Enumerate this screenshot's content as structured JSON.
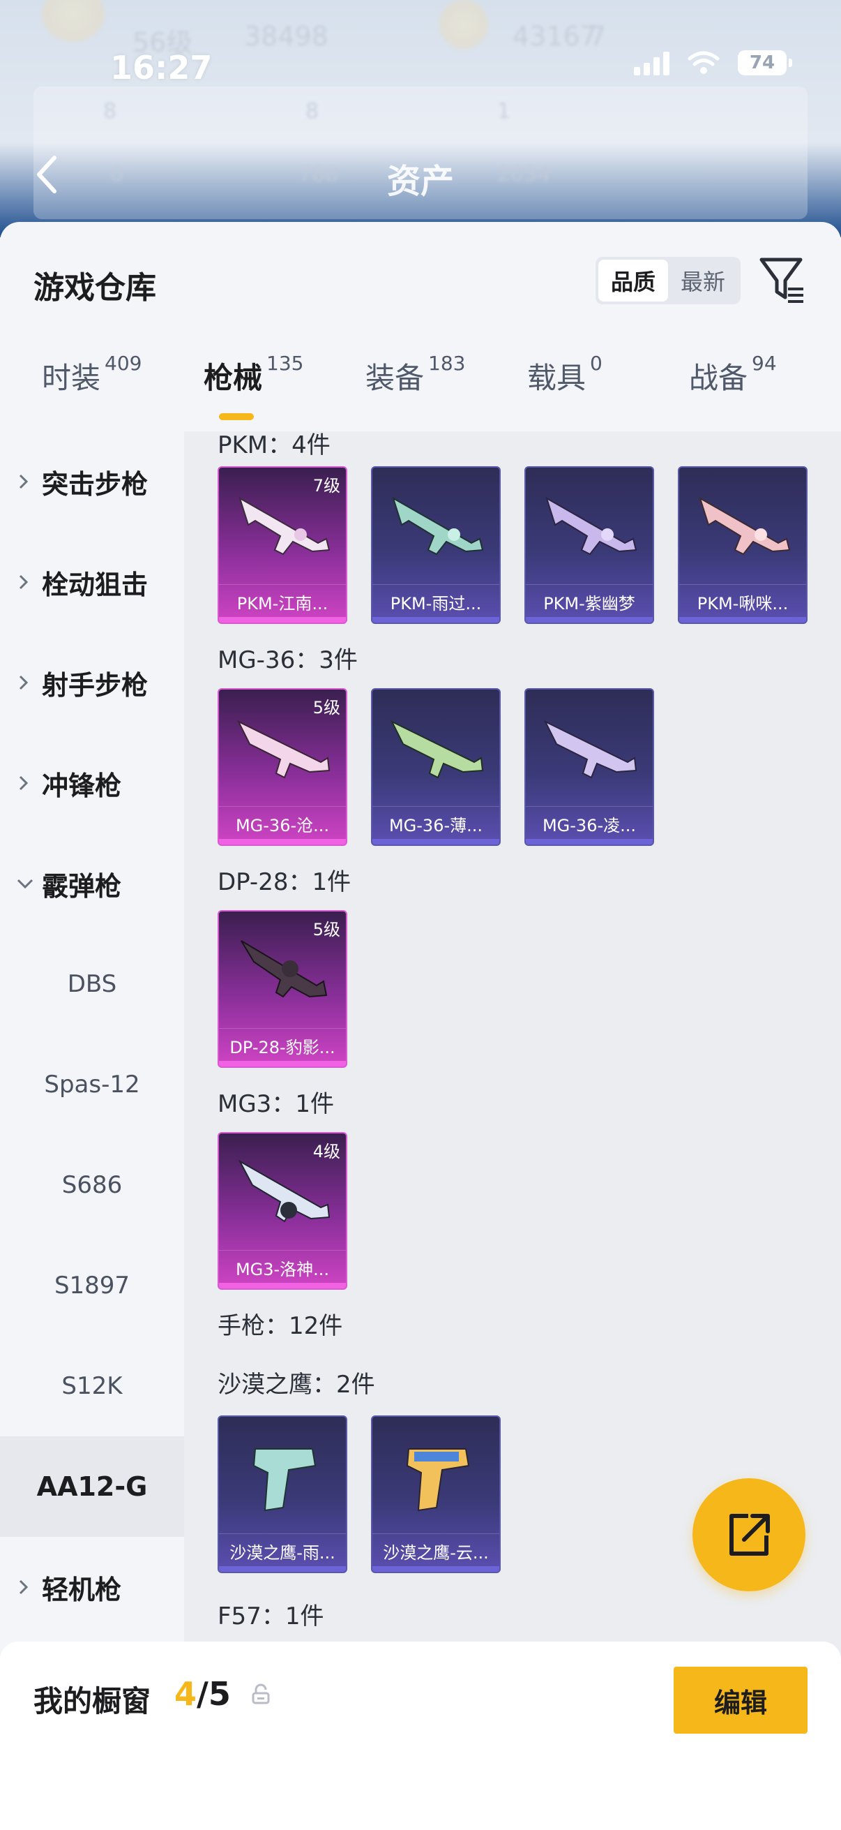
{
  "status_bar": {
    "time": "16:27",
    "battery": "74"
  },
  "header": {
    "title": "资产",
    "bg_texts": [
      "56级",
      "38498",
      "43167",
      "7",
      "8",
      "8",
      "1",
      "0",
      "788",
      "2034"
    ]
  },
  "sheet": {
    "title": "游戏仓库",
    "sort": {
      "options": [
        "品质",
        "最新"
      ],
      "selected": "品质"
    },
    "tabs": [
      {
        "label": "时装",
        "count": "409"
      },
      {
        "label": "枪械",
        "count": "135"
      },
      {
        "label": "装备",
        "count": "183"
      },
      {
        "label": "载具",
        "count": "0"
      },
      {
        "label": "战备",
        "count": "94"
      }
    ],
    "active_tab": "枪械"
  },
  "categories": [
    {
      "label": "突击步枪"
    },
    {
      "label": "栓动狙击"
    },
    {
      "label": "射手步枪"
    },
    {
      "label": "冲锋枪"
    },
    {
      "label": "霰弹枪",
      "expanded": true
    }
  ],
  "subcategories": [
    "DBS",
    "Spas-12",
    "S686",
    "S1897",
    "S12K",
    "AA12-G"
  ],
  "active_subcategory": "AA12-G",
  "last_category": {
    "label": "轻机枪"
  },
  "sections": [
    {
      "title": "PKM：4件",
      "items": [
        {
          "name": "PKM-江南...",
          "level": "7级",
          "rarity": "pink"
        },
        {
          "name": "PKM-雨过...",
          "level": "",
          "rarity": "purple"
        },
        {
          "name": "PKM-紫幽梦",
          "level": "",
          "rarity": "purple"
        },
        {
          "name": "PKM-啾咪...",
          "level": "",
          "rarity": "purple"
        }
      ]
    },
    {
      "title": "MG-36：3件",
      "items": [
        {
          "name": "MG-36-沧...",
          "level": "5级",
          "rarity": "pink"
        },
        {
          "name": "MG-36-薄...",
          "level": "",
          "rarity": "purple"
        },
        {
          "name": "MG-36-凌...",
          "level": "",
          "rarity": "purple"
        }
      ]
    },
    {
      "title": "DP-28：1件",
      "items": [
        {
          "name": "DP-28-豹影...",
          "level": "5级",
          "rarity": "pink"
        }
      ]
    },
    {
      "title": "MG3：1件",
      "items": [
        {
          "name": "MG3-洛神...",
          "level": "4级",
          "rarity": "pink"
        }
      ]
    },
    {
      "title": "手枪：12件",
      "items": []
    },
    {
      "title": "沙漠之鹰：2件",
      "items": [
        {
          "name": "沙漠之鹰-雨...",
          "level": "",
          "rarity": "purple"
        },
        {
          "name": "沙漠之鹰-云...",
          "level": "",
          "rarity": "purple"
        }
      ]
    },
    {
      "title": "F57：1件",
      "items": []
    }
  ],
  "showcase": {
    "label": "我的橱窗",
    "current": "4",
    "sep_total": "/5",
    "edit_label": "编辑"
  },
  "colors": {
    "accent": "#f6b71b",
    "purple_card": "#3b3a78",
    "pink_card": "#cf44c4"
  }
}
